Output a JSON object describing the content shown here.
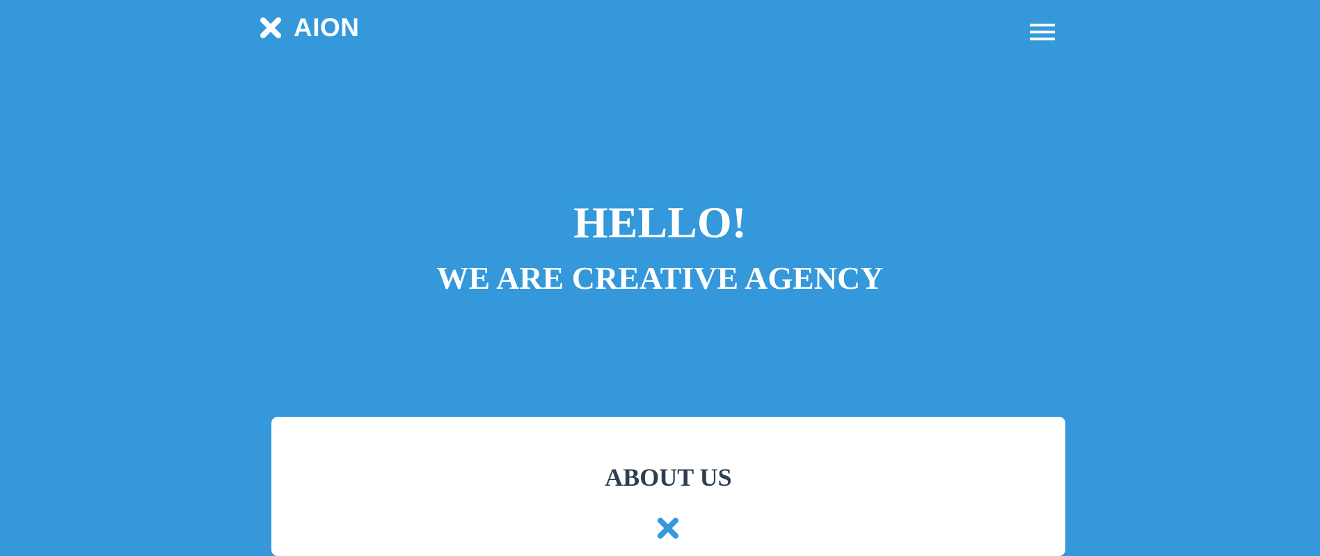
{
  "header": {
    "logo_text": "AION",
    "logo_icon": "x-icon",
    "menu_icon": "hamburger-menu-icon"
  },
  "hero": {
    "title": "HELLO!",
    "subtitle": "WE ARE CREATIVE AGENCY"
  },
  "about": {
    "title": "ABOUT US",
    "divider_icon": "x-icon"
  },
  "colors": {
    "background": "#3498db",
    "text_light": "#ffffff",
    "text_dark": "#2c3e50",
    "card": "#ffffff",
    "accent": "#3498db"
  }
}
